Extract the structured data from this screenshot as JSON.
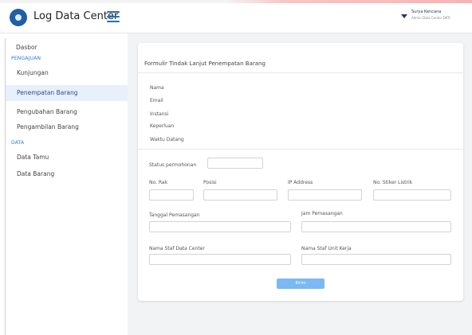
{
  "header": {
    "app_title": "Log Data Center",
    "user_name": "Surya Kencana",
    "user_role": "Admin Data Center DKTI"
  },
  "sidebar": {
    "items": [
      {
        "label": "Dasbor"
      },
      {
        "section": "PENGAJUAN"
      },
      {
        "label": "Kunjungan"
      },
      {
        "label": "Penempatan Barang",
        "active": true
      },
      {
        "label": "Pengubahan Barang"
      },
      {
        "label": "Pengambilan Barang"
      },
      {
        "section": "DATA"
      },
      {
        "label": "Data Tamu"
      },
      {
        "label": "Data Barang"
      }
    ]
  },
  "form": {
    "title": "Formulir Tindak Lanjut Penempatan Barang",
    "info_labels": [
      "Nama",
      "Email",
      "Instansi",
      "Keperluan",
      "Waktu Datang"
    ],
    "status_label": "Status permohonan",
    "status_value": "",
    "row1_labels": [
      "No. Rak",
      "Posisi",
      "IP Address",
      "No. Stiker Listrik"
    ],
    "tanggal_label": "Tanggal Pemasangan",
    "jam_label": "Jam Pemasangan",
    "staf_dc_label": "Nama Staf Data Center",
    "staf_unit_label": "Nama Staf Unit Kerja",
    "submit_label": "Kirim"
  },
  "colors": {
    "accent": "#1f6fb8",
    "active_bg": "#e8f0fb",
    "section_text": "#2a7bd8",
    "button": "#7ab9f2"
  }
}
